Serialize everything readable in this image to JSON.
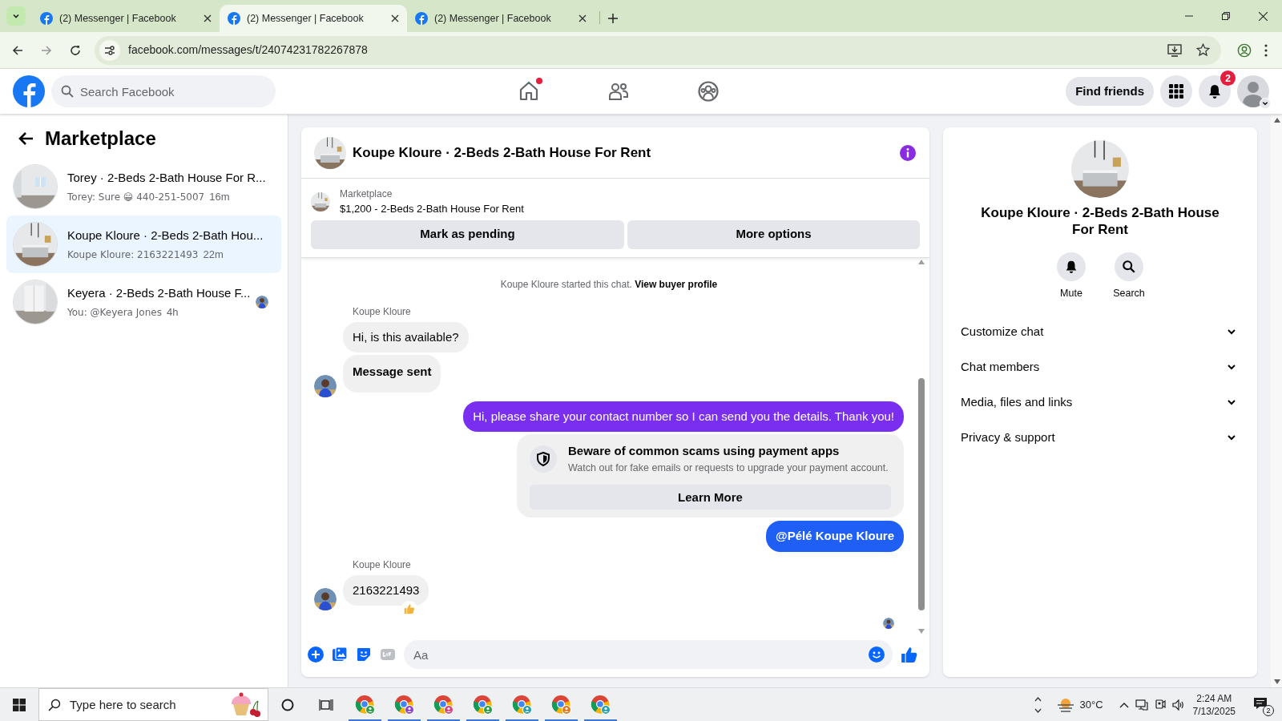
{
  "browser": {
    "tabs": [
      {
        "title": "(2) Messenger | Facebook",
        "selected": false
      },
      {
        "title": "(2) Messenger | Facebook",
        "selected": true
      },
      {
        "title": "(2) Messenger | Facebook",
        "selected": false
      }
    ],
    "url": "facebook.com/messages/t/24074231782267878"
  },
  "header": {
    "search_placeholder": "Search Facebook",
    "nav": [
      {
        "kind": "home",
        "badge": true
      },
      {
        "kind": "friends",
        "badge": false
      },
      {
        "kind": "groups",
        "badge": false
      }
    ],
    "find_friends": "Find friends",
    "notifications": "2"
  },
  "sidebar": {
    "title": "Marketplace",
    "conversations": [
      {
        "title": "Torey · 2-Beds 2-Bath House For R...",
        "preview": "Torey: Sure 😁 440-251-5007",
        "time": "16m",
        "selected": false,
        "seen": false
      },
      {
        "title": "Koupe Kloure · 2-Beds 2-Bath Hou...",
        "preview": "Koupe Kloure: 2163221493",
        "time": "22m",
        "selected": true,
        "seen": false
      },
      {
        "title": "Keyera · 2-Beds 2-Bath House F...",
        "preview": "You: @Keyera Jones",
        "time": "4h",
        "selected": false,
        "seen": true
      }
    ]
  },
  "chat": {
    "title": "Koupe Kloure · 2-Beds 2-Bath House For Rent",
    "listing": {
      "label": "Marketplace",
      "title": "$1,200 - 2-Beds 2-Bath House For Rent"
    },
    "actions": [
      "Mark as pending",
      "More options"
    ],
    "messages": [
      {
        "kind": "system",
        "text": "Koupe Kloure started this chat.",
        "link": "View buyer profile"
      },
      {
        "kind": "incoming",
        "sender": "Koupe Kloure",
        "bubbles": [
          {
            "text": "Hi, is this available?",
            "emphasis": false
          },
          {
            "text": "Message sent",
            "emphasis": true
          }
        ],
        "reacted": false
      },
      {
        "kind": "outgoing",
        "text": "Hi, please share your contact number so I can send you the details. Thank you!",
        "color": "#7a2ef0",
        "mention": false
      },
      {
        "kind": "notice",
        "title": "Beware of common scams using payment apps",
        "text": "Watch out for fake emails or requests to upgrade your payment account.",
        "button": "Learn More"
      },
      {
        "kind": "outgoing",
        "text": "@Pélé Koupe Kloure",
        "color": "#1f5ff5",
        "mention": true
      },
      {
        "kind": "incoming",
        "sender": "Koupe Kloure",
        "bubbles": [
          {
            "text": "2163221493",
            "emphasis": false
          }
        ],
        "reacted": true
      }
    ],
    "seen": true,
    "composer_placeholder": "Aa"
  },
  "details": {
    "title": "Koupe Kloure · 2-Beds 2-Bath House For Rent",
    "actions": [
      {
        "kind": "bell",
        "label": "Mute"
      },
      {
        "kind": "search",
        "label": "Search"
      }
    ],
    "sections": [
      "Customize chat",
      "Chat members",
      "Media, files and links",
      "Privacy & support"
    ]
  },
  "taskbar": {
    "search_placeholder": "Type here to search",
    "apps": [
      {
        "color": "#2e9d4a"
      },
      {
        "color": "#8e44c9"
      },
      {
        "color": "#d6457d"
      },
      {
        "color": "#2e9d4a"
      },
      {
        "color": "#2a9fb0"
      },
      {
        "color": "#e07b22"
      },
      {
        "color": "#2a9fb0"
      }
    ],
    "weather": "30°C",
    "time": "2:24 AM",
    "date": "7/13/2025",
    "notifications": "2"
  }
}
